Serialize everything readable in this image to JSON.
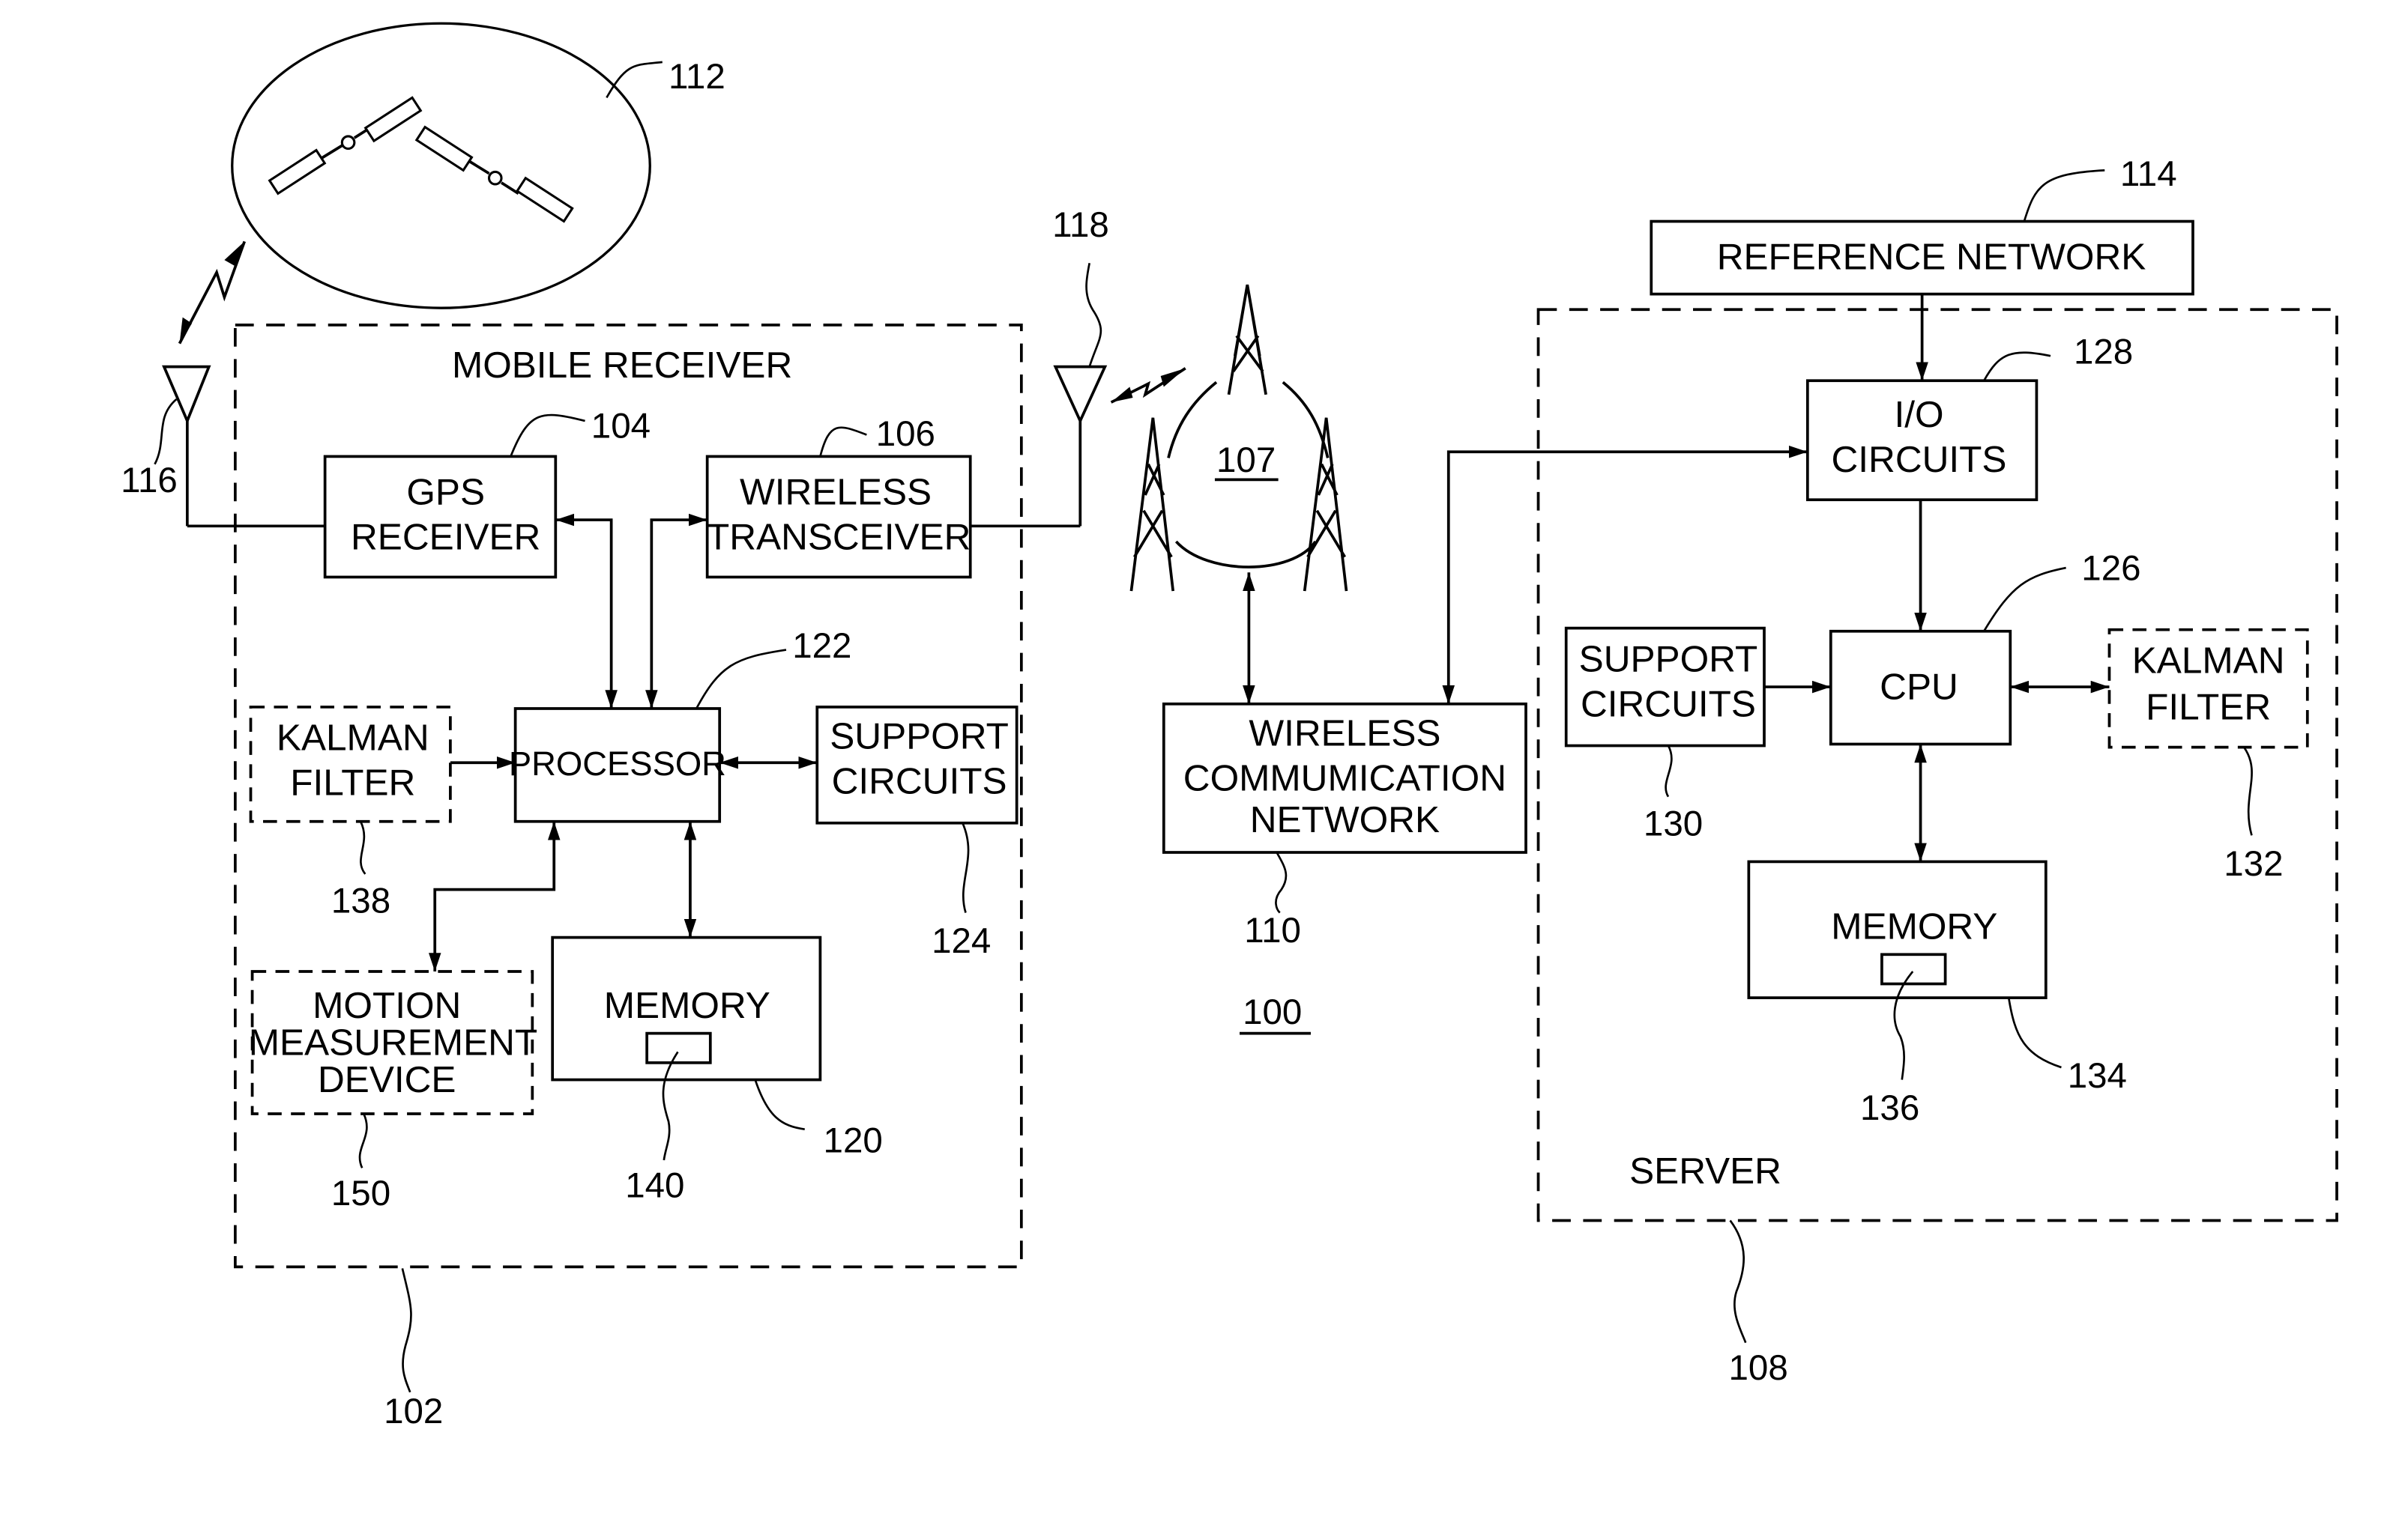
{
  "figure": {
    "system_ref": "100",
    "satellites": {
      "ref": "112"
    },
    "gps_antenna": {
      "ref": "116"
    },
    "wireless_antenna": {
      "ref": "118"
    },
    "cell_network": {
      "ref": "107"
    },
    "mobile_receiver": {
      "title": "MOBILE RECEIVER",
      "ref": "102",
      "gps_receiver": {
        "lines": [
          "GPS",
          "RECEIVER"
        ],
        "ref": "104"
      },
      "wireless_transceiver": {
        "lines": [
          "WIRELESS",
          "TRANSCEIVER"
        ],
        "ref": "106"
      },
      "kalman_filter": {
        "lines": [
          "KALMAN",
          "FILTER"
        ],
        "ref": "138"
      },
      "processor": {
        "lines": [
          "PROCESSOR"
        ],
        "ref": "122"
      },
      "support_circuits": {
        "lines": [
          "SUPPORT",
          "CIRCUITS"
        ],
        "ref": "124"
      },
      "motion_device": {
        "lines": [
          "MOTION",
          "MEASUREMENT",
          "DEVICE"
        ],
        "ref": "150"
      },
      "memory": {
        "lines": [
          "MEMORY"
        ],
        "ref": "120",
        "module_ref": "140"
      }
    },
    "wireless_network": {
      "lines": [
        "WIRELESS",
        "COMMUMICATION",
        "NETWORK"
      ],
      "ref": "110"
    },
    "reference_network": {
      "lines": [
        "REFERENCE NETWORK"
      ],
      "ref": "114"
    },
    "server": {
      "title": "SERVER",
      "ref": "108",
      "io_circuits": {
        "lines": [
          "I/O",
          "CIRCUITS"
        ],
        "ref": "128"
      },
      "cpu": {
        "lines": [
          "CPU"
        ],
        "ref": "126"
      },
      "support_circuits": {
        "lines": [
          "SUPPORT",
          "CIRCUITS"
        ],
        "ref": "130"
      },
      "kalman_filter": {
        "lines": [
          "KALMAN",
          "FILTER"
        ],
        "ref": "132"
      },
      "memory": {
        "lines": [
          "MEMORY"
        ],
        "ref": "134",
        "module_ref": "136"
      }
    }
  }
}
